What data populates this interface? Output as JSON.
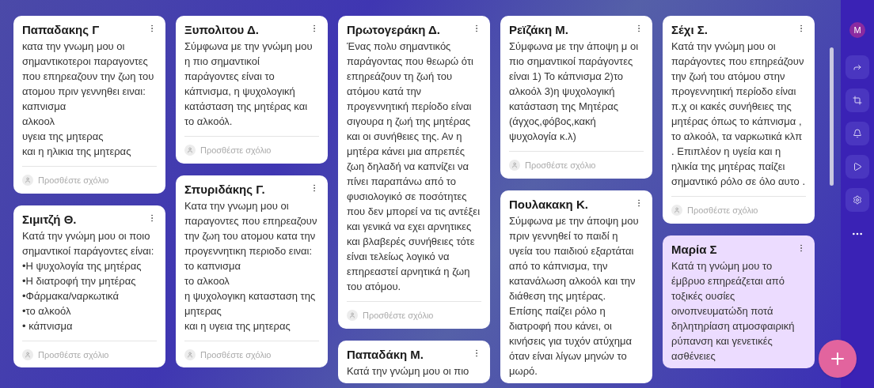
{
  "columns": [
    [
      {
        "title": "Παπαδακης Γ",
        "body": "κατα την γνωμη μου οι σημαντικοτεροι παραγοντες που επηρεαζουν την ζωη του ατομου πριν γεννηθει ειναι:\nκαπνισμα\nαλκοολ\nυγεια της μητερας\nκαι η ηλικια της μητερας",
        "comment_placeholder": "Προσθέστε σχόλιο",
        "color": "#ffffff"
      },
      {
        "title": "Σιμιτζή Θ.",
        "body": "Κατά την γνώμη μου οι ποιο σημαντικοί παράγοντες είναι:\n•Η ψυχολογία της μητέρας\n•Η διατροφή την μητέρας\n•Φάρμακα/ναρκωτικά\n•το αλκοόλ\n• κάπνισμα",
        "comment_placeholder": "Προσθέστε σχόλιο",
        "color": "#ffffff"
      }
    ],
    [
      {
        "title": "Ξυπολιτου Δ.",
        "body": "Σύμφωνα με την γνώμη μου η πιο σημαντικοί\nπαράγοντες είναι το κάπνισμα, η ψυχολογική κατάσταση της μητέρας και το αλκοόλ.",
        "comment_placeholder": "Προσθέστε σχόλιο",
        "color": "#ffffff"
      },
      {
        "title": "Σπυριδάκης Γ.",
        "body": "Κατα την γνωμη μου οι παραγοντες που επηρεαζουν την ζωη του ατομου κατα την προγεννητικη περιοδο ειναι:\nτο καπνισμα\nτο αλκοολ\nη ψυχολογικη κατασταση της μητερας\n και η υγεια της μητερας\n ",
        "comment_placeholder": "Προσθέστε σχόλιο",
        "color": "#ffffff"
      }
    ],
    [
      {
        "title": "Πρωτογεράκη Δ.",
        "body": "Ένας πολυ σημαντικός παράγοντας που θεωρώ ότι επηρεάζουν τη ζωή του ατόμου κατά την προγεννητική περίοδο είναι σιγουρα η ζωή της μητέρας και οι συνήθειες της. Αν η μητέρα κάνει μια απρεπές ζωη δηλαδή να καπνίζει να πίνει παραπάνω από το φυσιολογικό σε ποσότητες που δεν μπορεί να τις αντέξει και γενικά να εχει αρνητικες και βλαβερές συνήθειες τότε είναι τελείως λογικό να επηρεαστεί αρνητικά η ζωη του ατόμου.",
        "comment_placeholder": "Προσθέστε σχόλιο",
        "color": "#ffffff"
      },
      {
        "title": "Παπαδάκη Μ.",
        "body": "Κατά την γνώμη μου οι πιο",
        "color": "#ffffff"
      }
    ],
    [
      {
        "title": "Ρεϊζάκη Μ.",
        "body": "Σύμφωνα με την άποψη μ οι πιο σημαντικοί παράγοντες είναι 1) Το κάπνισμα 2)το αλκοόλ 3)η ψυχολογική κατάσταση της Μητέρας (άγχος,φόβος,κακή ψυχολογία κ.λ)",
        "comment_placeholder": "Προσθέστε σχόλιο",
        "color": "#ffffff"
      },
      {
        "title": "Πουλακακη Κ.",
        "body": "Σύμφωνα με την άποψη μου πριν γεννηθεί το παιδί η υγεία του παιδιού εξαρτάται από το κάπνισμα, την κατανάλωση αλκοόλ και την διάθεση της μητέρας.\nΕπίσης παίζει ρόλο η διατροφή που κάνει, οι κινήσεις για τυχόν ατύχημα όταν είναι λίγων μηνών το μωρό.",
        "color": "#ffffff"
      }
    ],
    [
      {
        "title": "Σέχι Σ.",
        "body": "Κατά την γνώμη μου οι παράγοντες που επηρεάζουν την ζωή του ατόμου στην προγεννητική περίοδο είναι π.χ οι κακές συνήθειες της μητέρας όπως το κάπνισμα , το αλκοόλ, τα ναρκωτικά κλπ . Επιπλέον η υγεία και η ηλικία της μητέρας παίζει σημαντικό ρόλο σε όλο αυτο .",
        "comment_placeholder": "Προσθέστε σχόλιο",
        "color": "#ffffff"
      },
      {
        "title": "Μαρία Σ",
        "body": "Κατά τη γνώμη μου το έμβρυο επηρεάζεται από τοξικές ουσίες οινοπνευματώδη ποτά δηλητηρίαση ατμοσφαιρική ρύπανση και γενετικές ασθένειες",
        "color": "#ecdcff"
      }
    ]
  ],
  "sidebar": {
    "avatar_letter": "M"
  }
}
